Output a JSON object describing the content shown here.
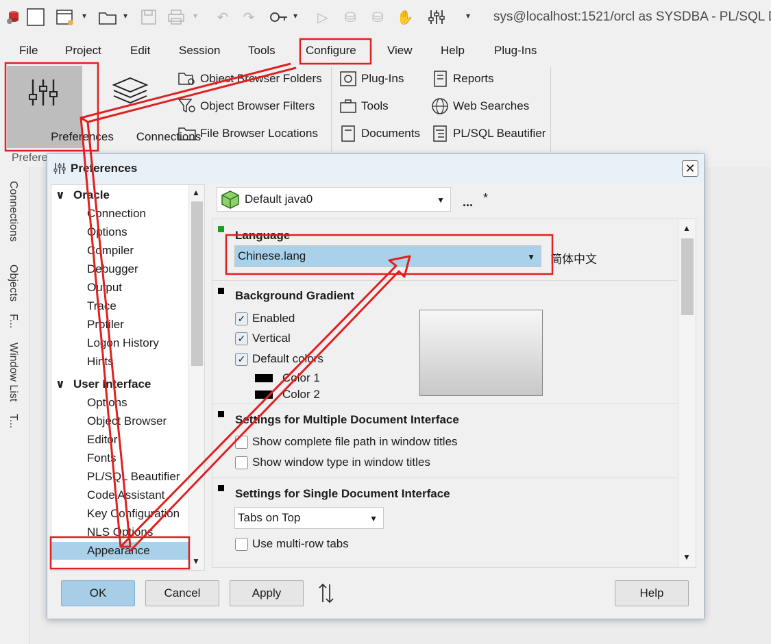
{
  "window": {
    "title": "sys@localhost:1521/orcl as SYSDBA - PL/SQL D"
  },
  "toolbar_icons": [
    "app-icon",
    "new-icon",
    "new-window-icon",
    "open-folder-icon",
    "save-icon",
    "print-icon",
    "undo-icon",
    "redo-icon",
    "key-icon",
    "execute-icon",
    "commit-icon",
    "rollback-icon",
    "break-icon",
    "preferences-icon"
  ],
  "menu": {
    "items": [
      "File",
      "Project",
      "Edit",
      "Session",
      "Tools",
      "Configure",
      "View",
      "Help",
      "Plug-Ins"
    ]
  },
  "ribbon": {
    "preferences_label": "Preferences",
    "connections_label": "Connections",
    "group_label": "Prefere",
    "items_col1": [
      "Object Browser Folders",
      "Object Browser Filters",
      "File Browser Locations"
    ],
    "items_col2": [
      "Plug-Ins",
      "Tools",
      "Documents"
    ],
    "items_col3": [
      "Reports",
      "Web Searches",
      "PL/SQL Beautifier"
    ]
  },
  "left_tabs": [
    "Connections",
    "Objects",
    "F...",
    "Window List",
    "T..."
  ],
  "dialog": {
    "title": "Preferences",
    "close_glyph": "✕",
    "tree": {
      "groups": [
        {
          "label": "Oracle",
          "items": [
            "Connection",
            "Options",
            "Compiler",
            "Debugger",
            "Output",
            "Trace",
            "Profiler",
            "Logon History",
            "Hints"
          ]
        },
        {
          "label": "User Interface",
          "items": [
            "Options",
            "Object Browser",
            "Editor",
            "Fonts",
            "PL/SQL Beautifier",
            "Code Assistant",
            "Key Configuration",
            "NLS Options",
            "Appearance"
          ]
        }
      ],
      "selected": "Appearance"
    },
    "profile": {
      "value": "Default java0",
      "more": "...",
      "modified_marker": "*"
    },
    "language": {
      "title": "Language",
      "value": "Chinese.lang",
      "native_name": "简体中文"
    },
    "background_gradient": {
      "title": "Background Gradient",
      "enabled": "Enabled",
      "vertical": "Vertical",
      "default_colors": "Default colors",
      "color1": "Color 1",
      "color2": "Color 2"
    },
    "mdi": {
      "title": "Settings for Multiple Document Interface",
      "full_path": "Show complete file path in window titles",
      "window_type": "Show window type in window titles"
    },
    "sdi": {
      "title": "Settings for Single Document Interface",
      "tabs_position": "Tabs on Top",
      "multirow": "Use multi-row tabs"
    },
    "buttons": {
      "ok": "OK",
      "cancel": "Cancel",
      "apply": "Apply",
      "help": "Help"
    }
  },
  "colors": {
    "accent": "#a8cde6",
    "selection": "#a9d1ea",
    "annotation": "#e02020",
    "active_mark": "#1aa01a"
  }
}
